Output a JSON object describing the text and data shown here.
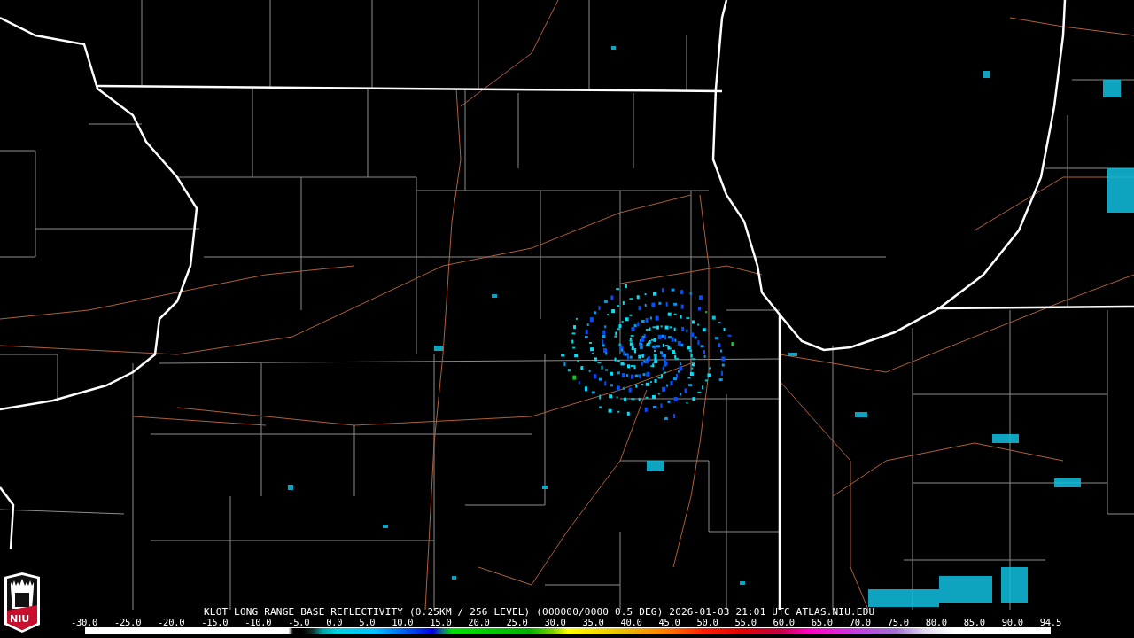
{
  "logo": {
    "text": "NIU"
  },
  "title": "KLOT LONG RANGE BASE REFLECTIVITY (0.25KM / 256 LEVEL) (000000/0000 0.5 DEG) 2026-01-03 21:01 UTC   ATLAS.NIU.EDU",
  "legend": {
    "ticks": [
      "-30.0",
      "-25.0",
      "-20.0",
      "-15.0",
      "-10.0",
      "-5.0",
      "0.0",
      "5.0",
      "10.0",
      "15.0",
      "20.0",
      "25.0",
      "30.0",
      "35.0",
      "40.0",
      "45.0",
      "50.0",
      "55.0",
      "60.0",
      "65.0",
      "70.0",
      "75.0",
      "80.0",
      "85.0",
      "90.0",
      "94.5"
    ]
  }
}
